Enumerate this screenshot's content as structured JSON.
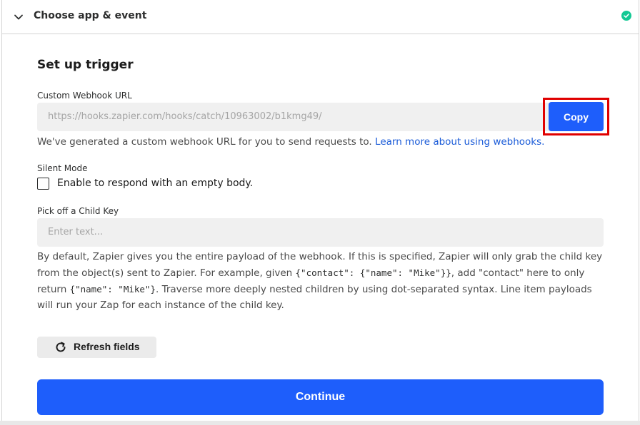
{
  "header": {
    "title": "Choose app & event",
    "status": "complete"
  },
  "section": {
    "title": "Set up trigger"
  },
  "webhook": {
    "label": "Custom Webhook URL",
    "url": "https://hooks.zapier.com/hooks/catch/10963002/b1kmg49/",
    "copy_label": "Copy",
    "help_text": "We've generated a custom webhook URL for you to send requests to.",
    "help_link": "Learn more about using webhooks."
  },
  "silent_mode": {
    "label": "Silent Mode",
    "checkbox_label": "Enable to respond with an empty body.",
    "checked": false
  },
  "child_key": {
    "label": "Pick off a Child Key",
    "placeholder": "Enter text...",
    "value": "",
    "help_part1": "By default, Zapier gives you the entire payload of the webhook. If this is specified, Zapier will only grab the child key from the object(s) sent to Zapier. For example, given ",
    "help_code1": "{\"contact\": {\"name\": \"Mike\"}}",
    "help_part2": ", add \"contact\" here to only return ",
    "help_code2": "{\"name\": \"Mike\"}",
    "help_part3": ". Traverse more deeply nested children by using dot-separated syntax. Line item payloads will run your Zap for each instance of the child key."
  },
  "actions": {
    "refresh_label": "Refresh fields",
    "continue_label": "Continue"
  },
  "colors": {
    "primary": "#1e5efb",
    "success": "#13c994",
    "highlight": "#e00000",
    "link": "#1a5bd8"
  }
}
